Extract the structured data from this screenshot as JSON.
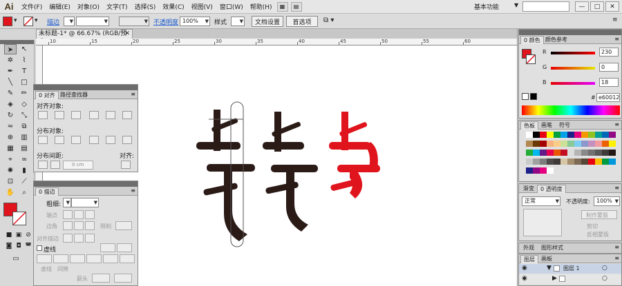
{
  "app": {
    "logo": "Ai"
  },
  "menubar": {
    "items": [
      "文件(F)",
      "编辑(E)",
      "对象(O)",
      "文字(T)",
      "选择(S)",
      "效果(C)",
      "视图(V)",
      "窗口(W)",
      "帮助(H)"
    ],
    "workspace": "基本功能",
    "window_buttons": [
      "—",
      "□",
      "✕"
    ]
  },
  "control_bar": {
    "stroke_label": "描边",
    "opacity_label": "不透明度",
    "opacity_value": "100%",
    "style_label": "样式",
    "doc_setup": "文档设置",
    "preferences": "首选项",
    "fill_color": "#e0141c"
  },
  "document": {
    "tab_title": "未标题-1* @ 66.67% (RGB/预览)",
    "close": "✕",
    "ruler_numbers": [
      "10",
      "15",
      "20",
      "25",
      "30",
      "35",
      "40",
      "45",
      "50",
      "55",
      "60"
    ]
  },
  "artwork": {
    "dark_color": "#2a1b16",
    "red_color": "#e0141c",
    "outline_color": "#555555"
  },
  "align_panel": {
    "tabs": [
      "0 对齐",
      "路径查找器"
    ],
    "align_objects_label": "对齐对象:",
    "distribute_objects_label": "分布对象:",
    "distribute_spacing_label": "分布间距:",
    "align_to_label": "对齐:",
    "spacing_value": "0 cm"
  },
  "stroke_panel": {
    "tab": "0 描边",
    "weight_label": "粗细:",
    "cap_label": "端点",
    "corner_label": "边角",
    "limit_label": "限制",
    "align_stroke_label": "对齐描边",
    "dashed_label": "虚线",
    "dash_label": "虚线",
    "gap_label": "间隙"
  },
  "color_panel": {
    "tabs": [
      "0 颜色",
      "颜色参考"
    ],
    "channels": [
      {
        "label": "R",
        "value": "230"
      },
      {
        "label": "G",
        "value": "0"
      },
      {
        "label": "B",
        "value": "18"
      }
    ],
    "hex_label": "#",
    "hex_value": "e60012"
  },
  "swatches_panel": {
    "tabs": [
      "色板",
      "画笔",
      "符号"
    ]
  },
  "transparency_panel": {
    "tabs": [
      "渐变",
      "0 透明度"
    ],
    "blend_mode": "正常",
    "opacity_label": "不透明度:",
    "opacity_value": "100%",
    "make_mask": "制作蒙版",
    "clip_label": "剪切",
    "invert_mask_label": "反相蒙版"
  },
  "appearance_panel": {
    "tabs": [
      "外观",
      "图形样式"
    ]
  },
  "layers_panel": {
    "tabs": [
      "图层",
      "画板"
    ],
    "layer_name": "图层 1"
  }
}
